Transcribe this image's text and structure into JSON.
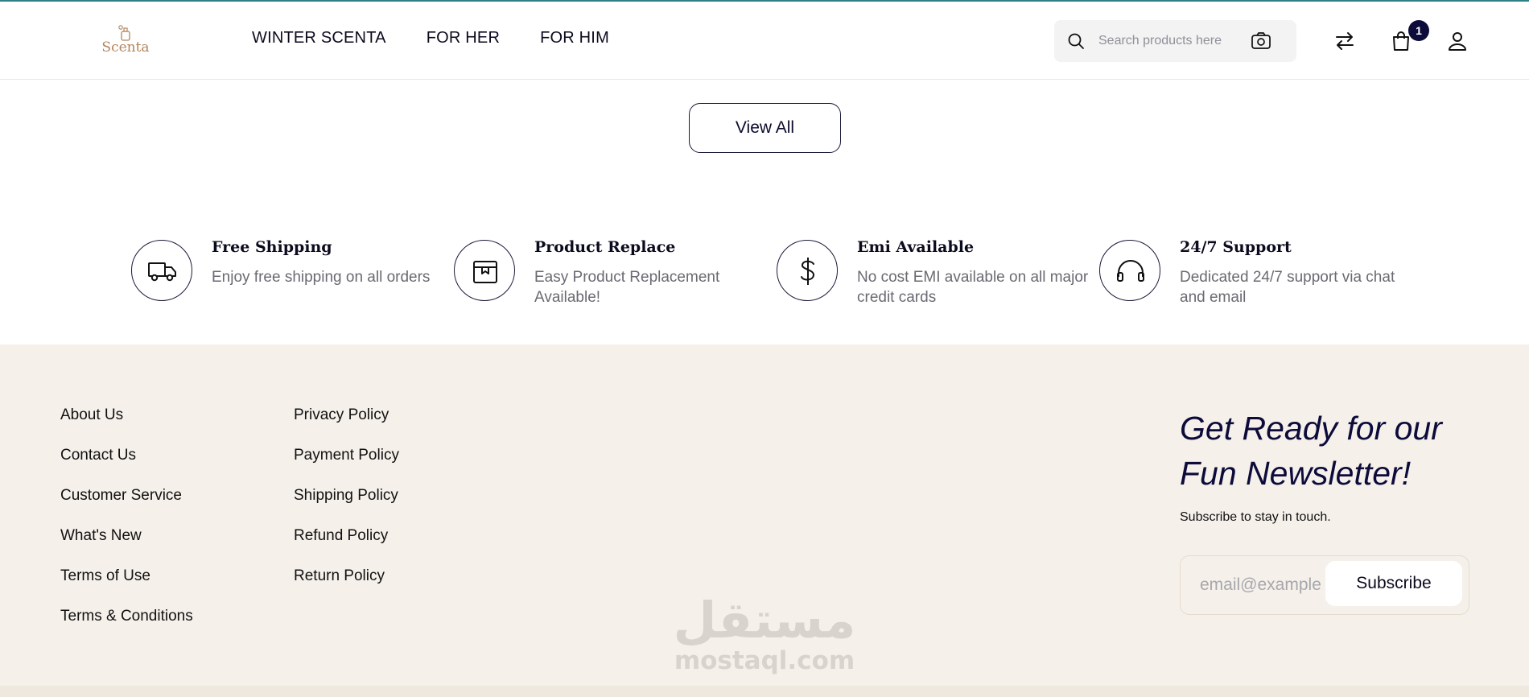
{
  "header": {
    "logo_text": "Scenta",
    "nav": [
      "WINTER SCENTA",
      "FOR HER",
      "FOR HIM"
    ],
    "search_placeholder": "Search products here",
    "cart_count": "1",
    "icons": [
      "search-icon",
      "camera-icon",
      "compare-icon",
      "cart-icon",
      "user-icon"
    ]
  },
  "view_all_label": "View All",
  "features": [
    {
      "title": "Free Shipping",
      "desc": "Enjoy free shipping on all orders",
      "icon": "truck-icon"
    },
    {
      "title": "Product Replace",
      "desc": "Easy Product Replacement Available!",
      "icon": "box-icon"
    },
    {
      "title": "Emi Available",
      "desc": "No cost EMI available on all major credit cards",
      "icon": "dollar-icon"
    },
    {
      "title": "24/7 Support",
      "desc": "Dedicated 24/7 support via chat and email",
      "icon": "headphones-icon"
    }
  ],
  "footer": {
    "col1": [
      "About Us",
      "Contact Us",
      "Customer Service",
      "What's New",
      "Terms of Use",
      "Terms & Conditions"
    ],
    "col2": [
      "Privacy Policy",
      "Payment Policy",
      "Shipping Policy",
      "Refund Policy",
      "Return Policy"
    ],
    "newsletter": {
      "title": "Get Ready for our Fun Newsletter!",
      "subtitle": "Subscribe to stay in touch.",
      "email_placeholder": "email@example.com",
      "button": "Subscribe"
    }
  },
  "watermark": {
    "arabic": "مستقل",
    "latin": "mostaql.com"
  },
  "colors": {
    "accent": "#0c0b3a",
    "footer_bg": "#f5f0ea",
    "logo": "#b3855a",
    "top_border": "#2f7f86"
  }
}
